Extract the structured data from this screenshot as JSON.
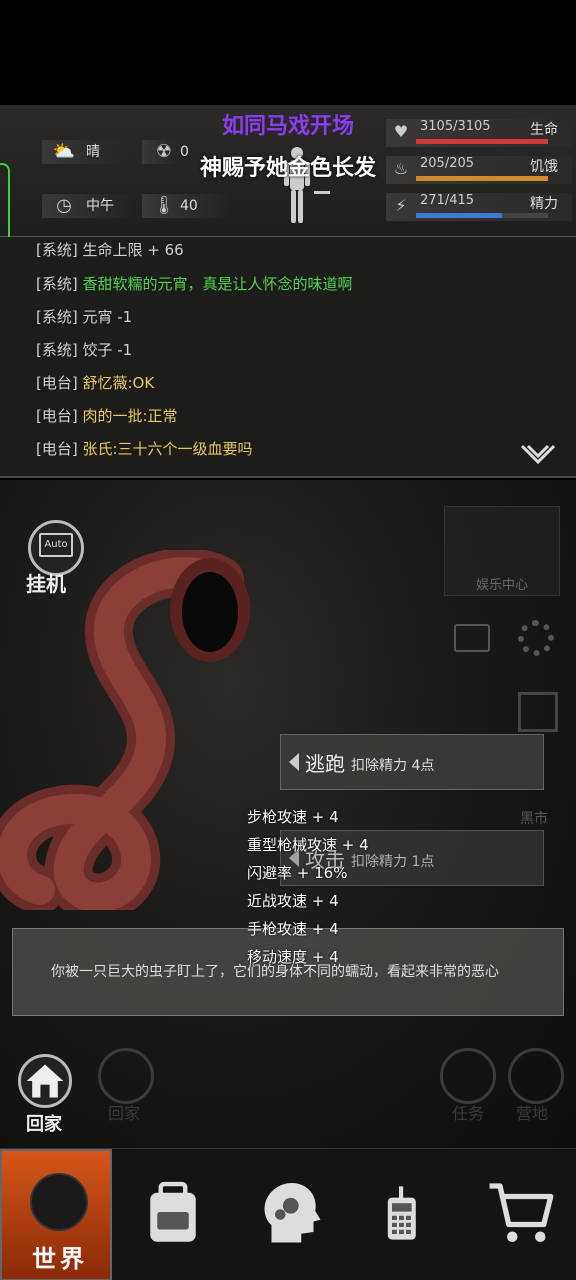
{
  "status": {
    "weather": "晴",
    "radiation": "0",
    "time_of_day": "中午",
    "temperature": "40",
    "hp": {
      "label": "生命",
      "value": "3105/3105",
      "fraction": 1.0,
      "color": "#d23a3a"
    },
    "hunger": {
      "label": "饥饿",
      "value": "205/205",
      "fraction": 1.0,
      "color": "#d08a30"
    },
    "energy": {
      "label": "精力",
      "value": "271/415",
      "fraction": 0.65,
      "color": "#3a78d2"
    }
  },
  "overlay": {
    "title_line1": "如同马戏开场",
    "title_line2": "神赐予她金色长发"
  },
  "log": [
    {
      "tag": "[系统]",
      "text": "生命上限 + 66",
      "color": "#cfcfcf"
    },
    {
      "tag": "[系统]",
      "text": "香甜软糯的元宵，真是让人怀念的味道啊",
      "color": "#4fd24f"
    },
    {
      "tag": "[系统]",
      "text": "元宵 -1",
      "color": "#cfcfcf"
    },
    {
      "tag": "[系统]",
      "text": "饺子 -1",
      "color": "#cfcfcf"
    },
    {
      "tag": "[电台]",
      "text": "舒忆薇:OK",
      "color": "#e8c860"
    },
    {
      "tag": "[电台]",
      "text": "肉的一批:正常",
      "color": "#e8c860"
    },
    {
      "tag": "[电台]",
      "text": "张氏:三十六个一级血要吗",
      "color": "#e8c860"
    }
  ],
  "scene": {
    "auto_label": "挂机",
    "auto_badge": "Auto",
    "entertainment_label": "娱乐中心",
    "market_label": "黑市",
    "actions": [
      {
        "name": "逃跑",
        "cost": "扣除精力 4点"
      },
      {
        "name": "攻击",
        "cost": "扣除精力 1点"
      }
    ],
    "buffs": [
      "步枪攻速 + 4",
      "重型枪械攻速 + 4",
      "闪避率 + 16%",
      "近战攻速 + 4",
      "手枪攻速 + 4",
      "移动速度 + 4"
    ],
    "message": "你被一只巨大的虫子盯上了，它们的身体不同的蠕动，看起来非常的恶心",
    "home_label": "回家",
    "faded_home_label": "回家",
    "task_label": "任务",
    "camp_label": "营地"
  },
  "nav": {
    "world_label": "世界",
    "items": [
      "backpack-icon",
      "skills-head-icon",
      "radio-icon",
      "cart-icon"
    ]
  }
}
